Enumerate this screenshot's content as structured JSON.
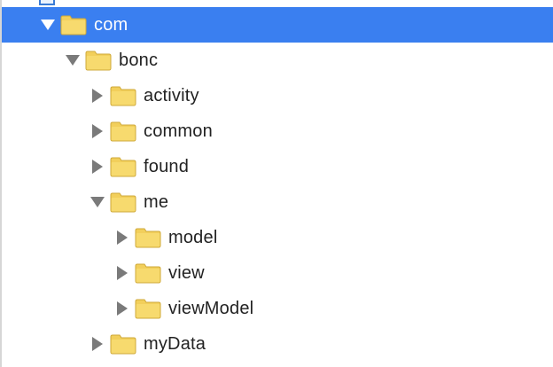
{
  "tree": {
    "items": [
      {
        "label": "com",
        "expanded": true,
        "selected": true
      },
      {
        "label": "bonc",
        "expanded": true,
        "selected": false
      },
      {
        "label": "activity",
        "expanded": false,
        "selected": false
      },
      {
        "label": "common",
        "expanded": false,
        "selected": false
      },
      {
        "label": "found",
        "expanded": false,
        "selected": false
      },
      {
        "label": "me",
        "expanded": true,
        "selected": false
      },
      {
        "label": "model",
        "expanded": false,
        "selected": false
      },
      {
        "label": "view",
        "expanded": false,
        "selected": false
      },
      {
        "label": "viewModel",
        "expanded": false,
        "selected": false
      },
      {
        "label": "myData",
        "expanded": false,
        "selected": false
      }
    ]
  },
  "colors": {
    "selection": "#3a7ff0",
    "folder": "#f2cf5b",
    "disclosure": "#7a7a7a"
  },
  "icons": {
    "folder": "folder-icon",
    "expanded": "disclosure-expanded-icon",
    "collapsed": "disclosure-collapsed-icon"
  }
}
